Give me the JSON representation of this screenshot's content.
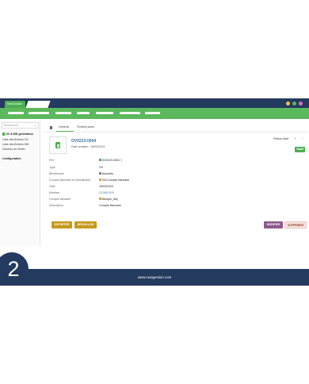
{
  "app": {
    "tab_label": "NextGestion",
    "window_dots": [
      "#f0c24b",
      "#5cb85c",
      "#e06ecd"
    ]
  },
  "menu": {
    "item_count": 7
  },
  "sidebar": {
    "search_placeholder": "Rechercher",
    "group_title": "OV & MD générateur",
    "links": [
      "Liste des fichiers OV",
      "Liste des fichiers MD",
      "Générer un fichier"
    ],
    "section_title": "Configuration"
  },
  "tabs": [
    "Général",
    "Fichiers joints"
  ],
  "record": {
    "id": "OV0223-0004",
    "creation_date": "Date création : 16/03/2023",
    "back_link": "Retour liste",
    "status_badge": "Validé"
  },
  "fields": [
    {
      "label": "Réf.",
      "value": "OV0223-0004"
    },
    {
      "label": "Type",
      "value": "OV"
    },
    {
      "label": "Bénéficiaire",
      "value": "Associés"
    },
    {
      "label": "Compte Bancaire du bénéficiaire",
      "value": "316-Compte bancaire"
    },
    {
      "label": "Date",
      "value": "16/03/2023"
    },
    {
      "label": "Montant",
      "value": "23 500,00 €"
    },
    {
      "label": "Compte bancaire",
      "value": "Banque_Ally"
    },
    {
      "label": "Description",
      "value": "Compte Bancaire"
    }
  ],
  "actions": {
    "exporter": "EXPORTER",
    "brouillon": "BROUILLON",
    "modifier": "MODIFIER",
    "supprimer": "SUPPRIMER"
  },
  "footer": {
    "step_number": "2",
    "website": "www.nextgestion.com"
  },
  "colors": {
    "navy": "#243a5e",
    "green": "#5cb85c",
    "gold": "#c79a1e",
    "purple": "#8e5b8c"
  }
}
